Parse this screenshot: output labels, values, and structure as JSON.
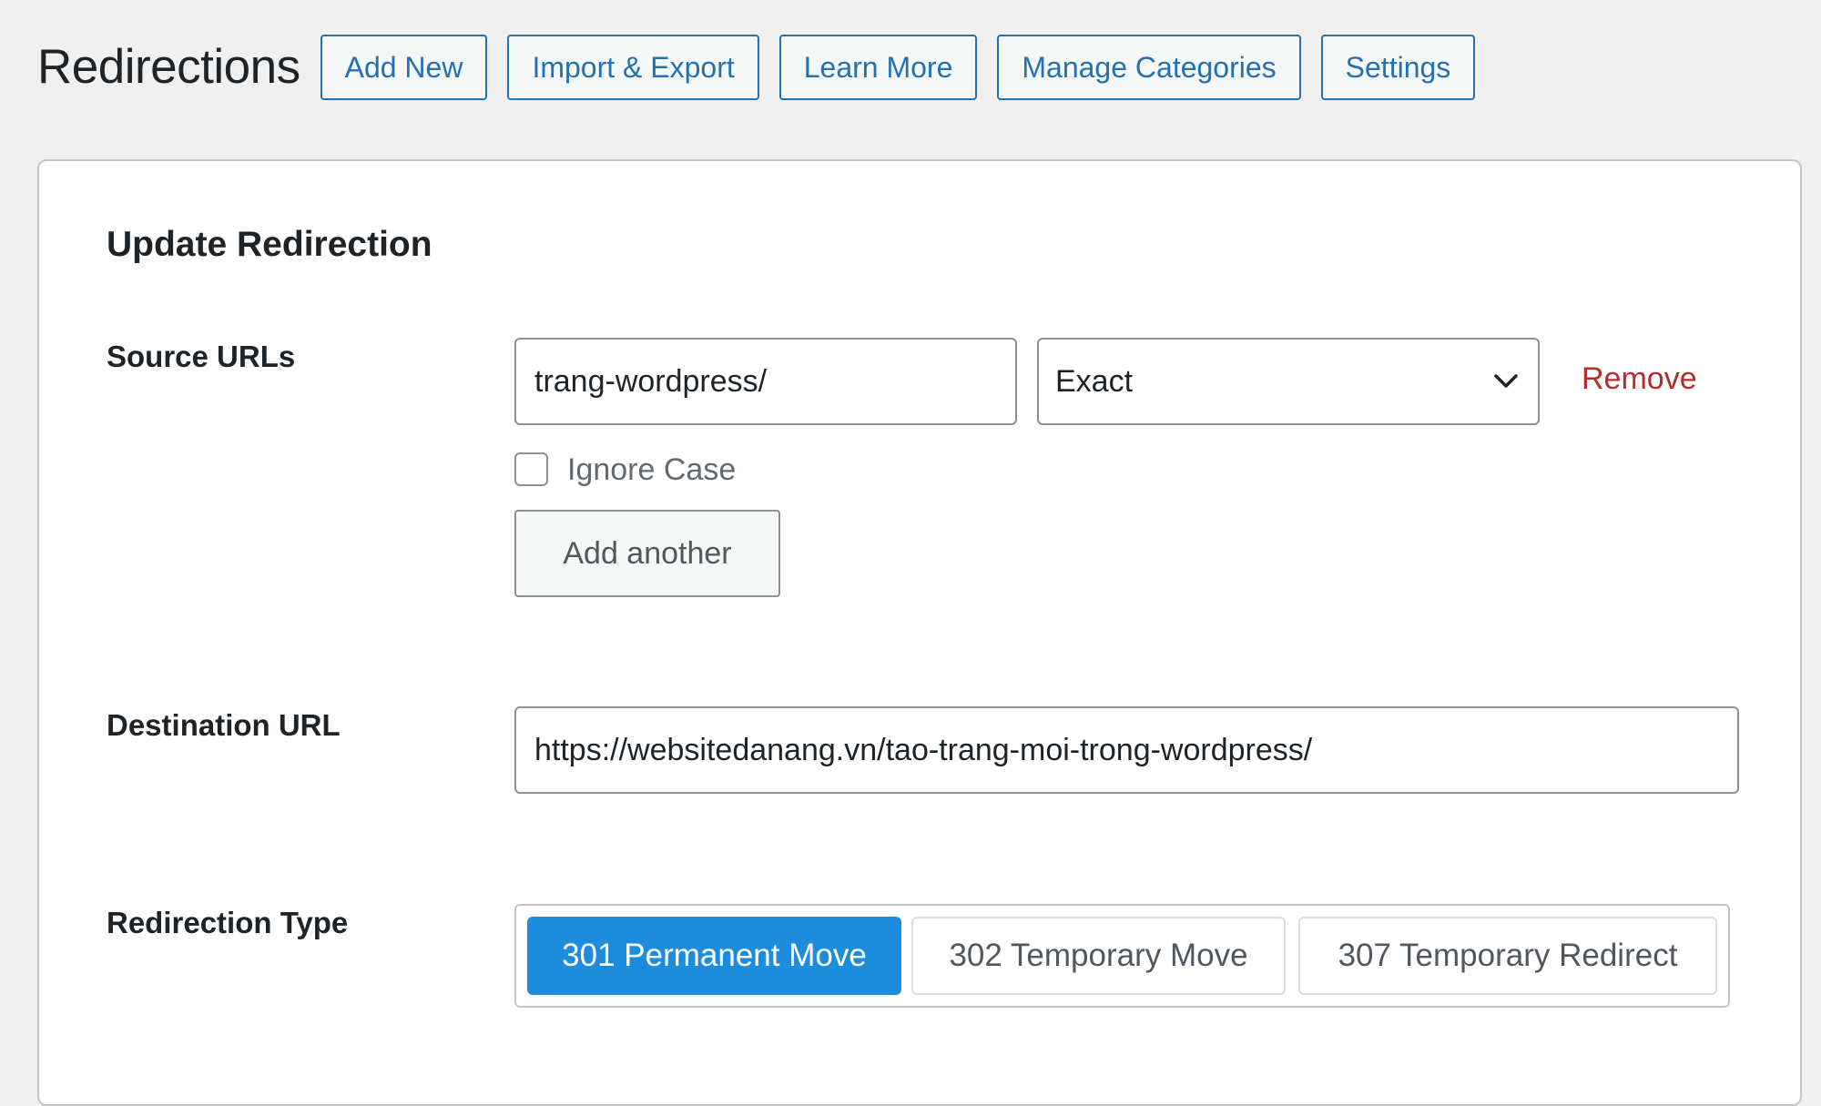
{
  "header": {
    "title": "Redirections",
    "buttons": {
      "add_new": "Add New",
      "import_export": "Import & Export",
      "learn_more": "Learn More",
      "manage_categories": "Manage Categories",
      "settings": "Settings"
    }
  },
  "form": {
    "title": "Update Redirection",
    "source": {
      "label": "Source URLs",
      "url_value": "trang-wordpress/",
      "match_type": "Exact",
      "remove_label": "Remove",
      "ignore_case_label": "Ignore Case",
      "ignore_case_checked": false,
      "add_another_label": "Add another"
    },
    "destination": {
      "label": "Destination URL",
      "url_value": "https://websitedanang.vn/tao-trang-moi-trong-wordpress/"
    },
    "redirection_type": {
      "label": "Redirection Type",
      "options": [
        "301 Permanent Move",
        "302 Temporary Move",
        "307 Temporary Redirect"
      ],
      "selected": "301 Permanent Move"
    }
  },
  "colors": {
    "accent": "#2271b1",
    "active_type": "#1e8cdd",
    "remove": "#b32d2e"
  },
  "icons": {
    "select_arrow": "chevron-down-icon"
  }
}
